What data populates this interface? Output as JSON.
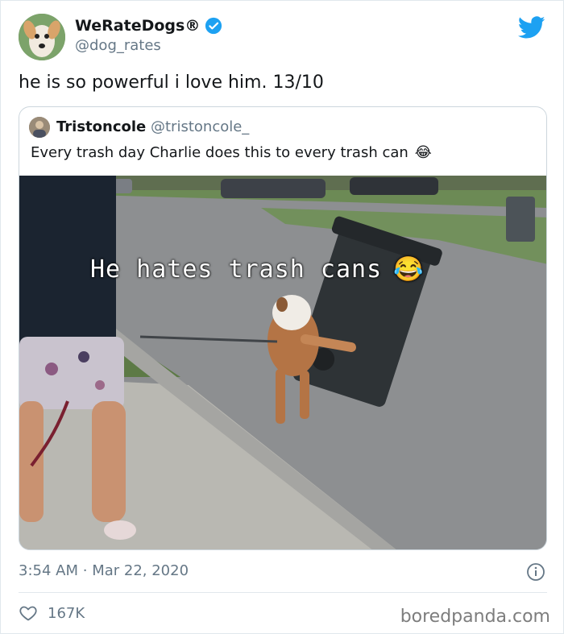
{
  "author": {
    "name": "WeRateDogs®",
    "handle": "@dog_rates",
    "avatar_icon": "dog-avatar",
    "verified_icon": "verified-badge-icon"
  },
  "tweet": {
    "text": "he is so powerful i love him. 13/10"
  },
  "quote": {
    "name": "Tristoncole",
    "handle": "@tristoncole_",
    "text": "Every trash day Charlie does this to every trash can",
    "emoji": "😂",
    "video_caption": "He hates trash cans",
    "video_caption_emoji": "😂"
  },
  "meta": {
    "time": "3:54 AM",
    "separator": "·",
    "date": "Mar 22, 2020",
    "likes": "167K"
  },
  "watermark": "boredpanda.com",
  "colors": {
    "twitter_blue": "#1da1f2",
    "secondary_text": "#657786",
    "border": "#e1e8ed"
  }
}
